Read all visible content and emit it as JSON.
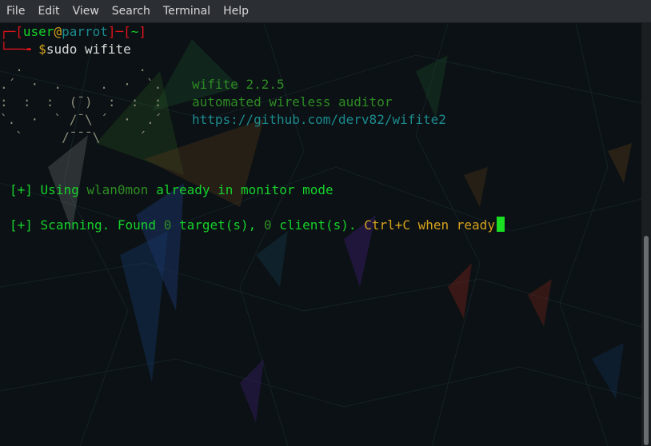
{
  "menu": [
    "File",
    "Edit",
    "View",
    "Search",
    "Terminal",
    "Help"
  ],
  "prompt": {
    "open1": "┌─[",
    "user": "user",
    "at": "@",
    "host": "parrot",
    "mid": "]─[",
    "dir": "~",
    "close": "]",
    "arrow": "└──╼ ",
    "dollar": "$",
    "command": "sudo wifite"
  },
  "art": [
    "  .               .    ",
    ".´  ·  .     .  ·  `.",
    ":  :  :  (¯)  :  :  :",
    "`.  ·  ` /¯\\ ´  ·  .´",
    "  `     /¯¯¯\\     ´  "
  ],
  "banner": {
    "name": "wifite",
    "version": "2.2.5",
    "tagline": "automated wireless auditor",
    "url": "https://github.com/derv82/wifite2"
  },
  "msg1": {
    "prefix": "[+]",
    "text1": "Using",
    "iface": "wlan0mon",
    "text2": "already in monitor mode"
  },
  "msg2": {
    "prefix": "[+]",
    "text1": "Scanning. Found",
    "targets": "0",
    "text2": "target(s),",
    "clients": "0",
    "text3": "client(s).",
    "hint": "Ctrl+C when ready"
  },
  "colors": {
    "background": "#0b1114",
    "prompt_red": "#e0141b",
    "text_green": "#17d12b",
    "url_cyan": "#1c8a8e",
    "hint_yellow": "#d7a21d",
    "cursor": "#19e023"
  }
}
